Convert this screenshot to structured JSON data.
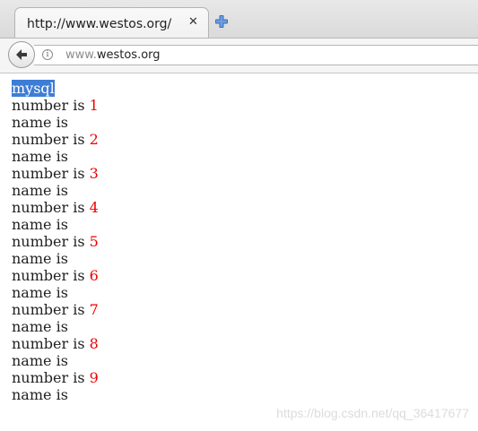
{
  "tab": {
    "title": "http://www.westos.org/",
    "close_glyph": "✕",
    "close_icon": "close-icon",
    "new_tab_icon": "plus-icon",
    "new_tab_color": "#3c6db5"
  },
  "navbar": {
    "back_icon": "back-arrow-icon",
    "info_icon": "info-icon",
    "info_glyph": "i",
    "url_prefix": "www.",
    "url_domain": "westos.org"
  },
  "content": {
    "heading": "mysql",
    "rows": [
      {
        "number_label": "number is ",
        "number": "1",
        "name_label": "name is"
      },
      {
        "number_label": "number is ",
        "number": "2",
        "name_label": "name is"
      },
      {
        "number_label": "number is ",
        "number": "3",
        "name_label": "name is"
      },
      {
        "number_label": "number is ",
        "number": "4",
        "name_label": "name is"
      },
      {
        "number_label": "number is ",
        "number": "5",
        "name_label": "name is"
      },
      {
        "number_label": "number is ",
        "number": "6",
        "name_label": "name is"
      },
      {
        "number_label": "number is ",
        "number": "7",
        "name_label": "name is"
      },
      {
        "number_label": "number is ",
        "number": "8",
        "name_label": "name is"
      },
      {
        "number_label": "number is ",
        "number": "9",
        "name_label": "name is"
      }
    ]
  },
  "watermark": "https://blog.csdn.net/qq_36417677",
  "colors": {
    "number_red": "#ee0000",
    "selection_blue": "#3d7dd6"
  }
}
